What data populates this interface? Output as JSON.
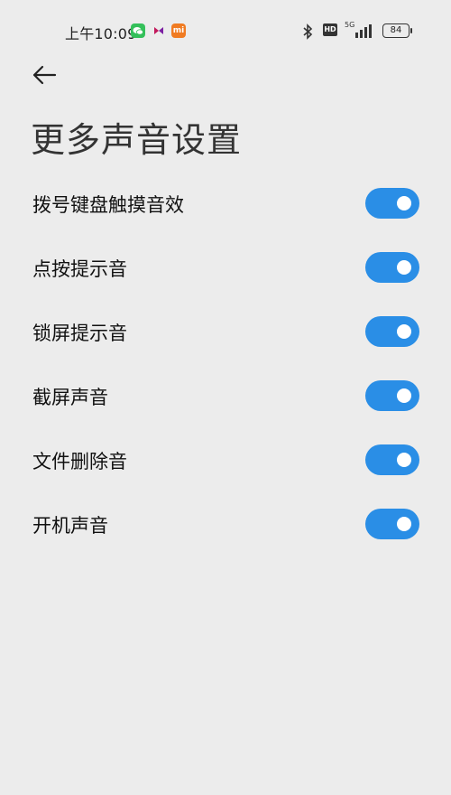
{
  "status_bar": {
    "time": "上午10:09",
    "mi_label": "mi",
    "hd_label": "HD",
    "network": "5G",
    "battery": "84"
  },
  "header": {
    "title": "更多声音设置"
  },
  "settings": [
    {
      "label": "拨号键盘触摸音效",
      "enabled": true
    },
    {
      "label": "点按提示音",
      "enabled": true
    },
    {
      "label": "锁屏提示音",
      "enabled": true
    },
    {
      "label": "截屏声音",
      "enabled": true
    },
    {
      "label": "文件删除音",
      "enabled": true
    },
    {
      "label": "开机声音",
      "enabled": true
    }
  ],
  "colors": {
    "background": "#ececec",
    "toggle_on": "#2a8ee6"
  }
}
